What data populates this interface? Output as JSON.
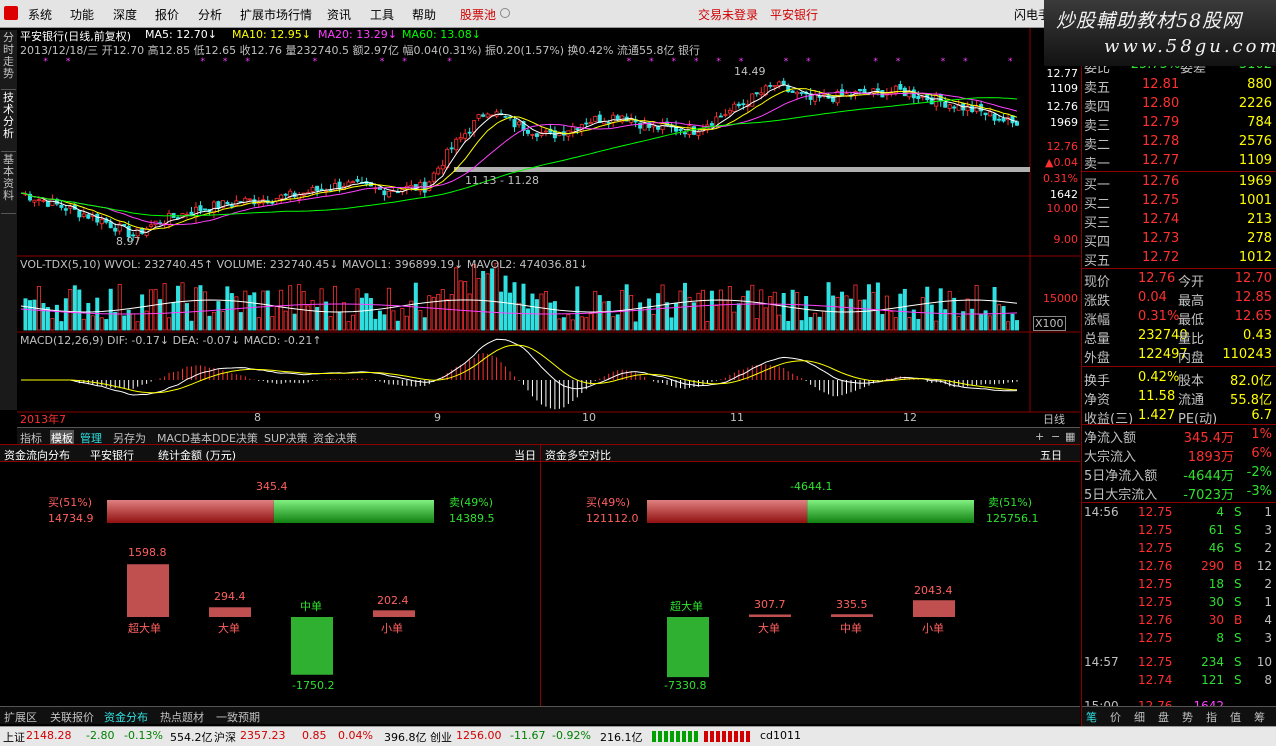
{
  "menu": {
    "items": [
      "系统",
      "功能",
      "深度",
      "报价",
      "分析",
      "扩展市场行情",
      "资讯",
      "工具",
      "帮助"
    ],
    "stock_pool": "股票池",
    "login": "交易未登录",
    "stock_name": "平安银行",
    "flash": "闪电手"
  },
  "watermark": {
    "line1": "炒股輔助教材58股网",
    "line2": "www.58gu.com"
  },
  "side_tabs": [
    "分时走势",
    "技术分析",
    "基本资料"
  ],
  "chart": {
    "title": "平安银行(日线,前复权)",
    "ma5": "MA5: 12.70↓",
    "ma10": "MA10: 12.95↓",
    "ma20": "MA20: 13.29↓",
    "ma60": "MA60: 13.08↓",
    "info": "2013/12/18/三 开12.70 高12.85 低12.65 收12.76 量232740.5 额2.97亿 幅0.04(0.31%) 振0.20(1.57%) 换0.42% 流通55.8亿 银行",
    "high_label": "14.49",
    "low_label": "8.97",
    "range_label": "11.13 - 11.28",
    "y_right": [
      "12.77",
      "1109",
      "12.76",
      "1969",
      "12.76",
      "▲0.04",
      "0.31%",
      "1642",
      "10.00",
      "9.00"
    ],
    "vol_header": "VOL-TDX(5,10)  WVOL: 232740.45↑  VOLUME: 232740.45↓  MAVOL1: 396899.19↓  MAVOL2: 474036.81↓",
    "vol_y": "15000",
    "vol_unit": "X100",
    "macd_header": "MACD(12,26,9)  DIF: -0.17↓  DEA: -0.07↓  MACD: -0.21↑",
    "x_labels": [
      "2013年7",
      "8",
      "9",
      "10",
      "11",
      "12"
    ],
    "period": "日线"
  },
  "chart_data": {
    "type": "candlestick",
    "series": [
      {
        "name": "MA5",
        "values": [
          12.7
        ]
      },
      {
        "name": "MA10",
        "values": [
          12.95
        ]
      },
      {
        "name": "MA20",
        "values": [
          13.29
        ]
      },
      {
        "name": "MA60",
        "values": [
          13.08
        ]
      }
    ],
    "last": {
      "open": 12.7,
      "high": 12.85,
      "low": 12.65,
      "close": 12.76,
      "volume": 232740.5
    },
    "ylim": [
      8.5,
      15
    ]
  },
  "bottom_tabs": [
    "指标",
    "模板",
    "管理",
    "另存为",
    "MACD基本",
    "DDE决策",
    "SUP决策",
    "资金决策"
  ],
  "flow": {
    "title": "资金流向分布",
    "stock": "平安银行",
    "stat": "统计金额 (万元)",
    "period": "当日",
    "buy_label": "买(51%)",
    "buy_val": "14734.9",
    "sell_label": "卖(49%)",
    "sell_val": "14389.5",
    "net": "345.4",
    "bars": [
      {
        "name": "超大单",
        "val": "1598.8",
        "v": 1598.8
      },
      {
        "name": "大单",
        "val": "294.4",
        "v": 294.4
      },
      {
        "name": "中单",
        "val": "-1750.2",
        "v": -1750.2
      },
      {
        "name": "小单",
        "val": "202.4",
        "v": 202.4
      }
    ]
  },
  "flow2": {
    "title": "资金多空对比",
    "period": "五日",
    "buy_label": "买(49%)",
    "buy_val": "121112.0",
    "sell_label": "卖(51%)",
    "sell_val": "125756.1",
    "net": "-4644.1",
    "bars": [
      {
        "name": "超大单",
        "val": "-7330.8",
        "v": -7330.8
      },
      {
        "name": "大单",
        "val": "307.7",
        "v": 307.7
      },
      {
        "name": "中单",
        "val": "335.5",
        "v": 335.5
      },
      {
        "name": "小单",
        "val": "2043.4",
        "v": 2043.4
      }
    ]
  },
  "quote": {
    "ratio_l": "委比",
    "ratio": "-25.75%",
    "diff_l": "委差",
    "diff": "-3102",
    "sells": [
      {
        "l": "卖五",
        "p": "12.81",
        "v": "880"
      },
      {
        "l": "卖四",
        "p": "12.80",
        "v": "2226"
      },
      {
        "l": "卖三",
        "p": "12.79",
        "v": "784"
      },
      {
        "l": "卖二",
        "p": "12.78",
        "v": "2576"
      },
      {
        "l": "卖一",
        "p": "12.77",
        "v": "1109"
      }
    ],
    "buys": [
      {
        "l": "买一",
        "p": "12.76",
        "v": "1969"
      },
      {
        "l": "买二",
        "p": "12.75",
        "v": "1001"
      },
      {
        "l": "买三",
        "p": "12.74",
        "v": "213"
      },
      {
        "l": "买四",
        "p": "12.73",
        "v": "278"
      },
      {
        "l": "买五",
        "p": "12.72",
        "v": "1012"
      }
    ],
    "stats": [
      {
        "a": "现价",
        "av": "12.76",
        "b": "今开",
        "bv": "12.70"
      },
      {
        "a": "涨跌",
        "av": "0.04",
        "b": "最高",
        "bv": "12.85"
      },
      {
        "a": "涨幅",
        "av": "0.31%",
        "b": "最低",
        "bv": "12.65"
      },
      {
        "a": "总量",
        "av": "232740",
        "b": "量比",
        "bv": "0.43"
      },
      {
        "a": "外盘",
        "av": "122497",
        "b": "内盘",
        "bv": "110243"
      },
      {
        "a": "换手",
        "av": "0.42%",
        "b": "股本",
        "bv": "82.0亿"
      },
      {
        "a": "净资",
        "av": "11.58",
        "b": "流通",
        "bv": "55.8亿"
      },
      {
        "a": "收益(三)",
        "av": "1.427",
        "b": "PE(动)",
        "bv": "6.7"
      }
    ],
    "flows": [
      {
        "l": "净流入额",
        "v": "345.4万",
        "p": "1%"
      },
      {
        "l": "大宗流入",
        "v": "1893万",
        "p": "6%"
      },
      {
        "l": "5日净流入额",
        "v": "-4644万",
        "p": "-2%"
      },
      {
        "l": "5日大宗流入",
        "v": "-7023万",
        "p": "-3%"
      }
    ]
  },
  "ticks": [
    {
      "t": "14:56",
      "p": "12.75",
      "v": "4",
      "s": "S",
      "n": "1"
    },
    {
      "t": "",
      "p": "12.75",
      "v": "61",
      "s": "S",
      "n": "3"
    },
    {
      "t": "",
      "p": "12.75",
      "v": "46",
      "s": "S",
      "n": "2"
    },
    {
      "t": "",
      "p": "12.76",
      "v": "290",
      "s": "B",
      "n": "12"
    },
    {
      "t": "",
      "p": "12.75",
      "v": "18",
      "s": "S",
      "n": "2"
    },
    {
      "t": "",
      "p": "12.75",
      "v": "30",
      "s": "S",
      "n": "1"
    },
    {
      "t": "",
      "p": "12.76",
      "v": "30",
      "s": "B",
      "n": "4"
    },
    {
      "t": "",
      "p": "12.75",
      "v": "8",
      "s": "S",
      "n": "3"
    },
    {
      "t": "14:57",
      "p": "12.75",
      "v": "234",
      "s": "S",
      "n": "10"
    },
    {
      "t": "",
      "p": "12.74",
      "v": "121",
      "s": "S",
      "n": "8"
    },
    {
      "t": "15:00",
      "p": "12.76",
      "v": "1642",
      "s": "",
      "n": ""
    }
  ],
  "right_tabs": [
    "笔",
    "价",
    "细",
    "盘",
    "势",
    "指",
    "值",
    "筹"
  ],
  "status": {
    "sh_l": "上证",
    "sh": "2148.28",
    "sh_c": "-2.80",
    "sh_p": "-0.13%",
    "sh_a": "554.2亿",
    "sz_l": "沪深",
    "sz": "2357.23",
    "sz_c": "0.85",
    "sz_p": "0.04%",
    "sz_a": "396.8亿",
    "cy_l": "创业",
    "cy": "1256.00",
    "cy_c": "-11.67",
    "cy_p": "-0.92%",
    "cy_a": "216.1亿",
    "code": "cd1011"
  },
  "lower_tabs": [
    "扩展区",
    "关联报价",
    "资金分布",
    "热点题材",
    "一致预期"
  ],
  "colors": {
    "up": "#ff3030",
    "down": "#30e0e0",
    "ma5": "#ffffff",
    "ma10": "#ffff00",
    "ma20": "#ff40ff",
    "ma60": "#00ff00"
  }
}
